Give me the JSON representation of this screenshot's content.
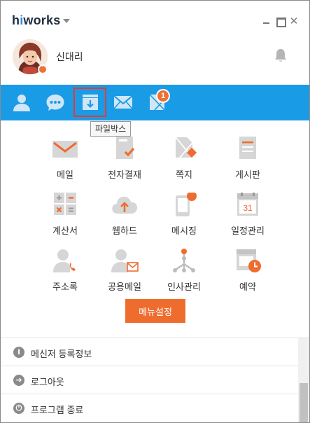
{
  "app": {
    "logo_prefix": "h",
    "logo_dot": "i",
    "logo_rest": "works"
  },
  "window_controls": {
    "close": "✕"
  },
  "profile": {
    "name": "신대리"
  },
  "toolbar": {
    "items": [
      "contacts-icon",
      "chat-icon",
      "filebox-icon",
      "mail-icon",
      "note-icon"
    ],
    "note_badge": "1",
    "active": "filebox"
  },
  "tooltip": {
    "text": "파일박스"
  },
  "menu": [
    {
      "label": "메일",
      "icon": "mail-icon"
    },
    {
      "label": "전자결재",
      "icon": "approval-icon"
    },
    {
      "label": "쪽지",
      "icon": "note-icon"
    },
    {
      "label": "게시판",
      "icon": "board-icon"
    },
    {
      "label": "계산서",
      "icon": "calculator-icon"
    },
    {
      "label": "웹하드",
      "icon": "cloud-upload-icon"
    },
    {
      "label": "메시징",
      "icon": "phone-message-icon"
    },
    {
      "label": "일정관리",
      "icon": "calendar-icon"
    },
    {
      "label": "주소록",
      "icon": "address-book-icon"
    },
    {
      "label": "공용메일",
      "icon": "shared-mail-icon"
    },
    {
      "label": "인사관리",
      "icon": "org-chart-icon"
    },
    {
      "label": "예약",
      "icon": "reservation-icon"
    }
  ],
  "menu_settings_label": "메뉴설정",
  "bottom_menu": [
    {
      "label": "메신저 등록정보",
      "icon": "info-icon",
      "glyph": "i"
    },
    {
      "label": "로그아웃",
      "icon": "logout-icon",
      "glyph": "➜"
    },
    {
      "label": "프로그램 종료",
      "icon": "power-icon",
      "glyph": "⏻"
    }
  ],
  "colors": {
    "toolbar_blue": "#1a9be6",
    "accent_orange": "#ef6c2f",
    "icon_gray": "#cfcfcf",
    "active_frame_red": "#e53935"
  },
  "calendar_day": "31"
}
